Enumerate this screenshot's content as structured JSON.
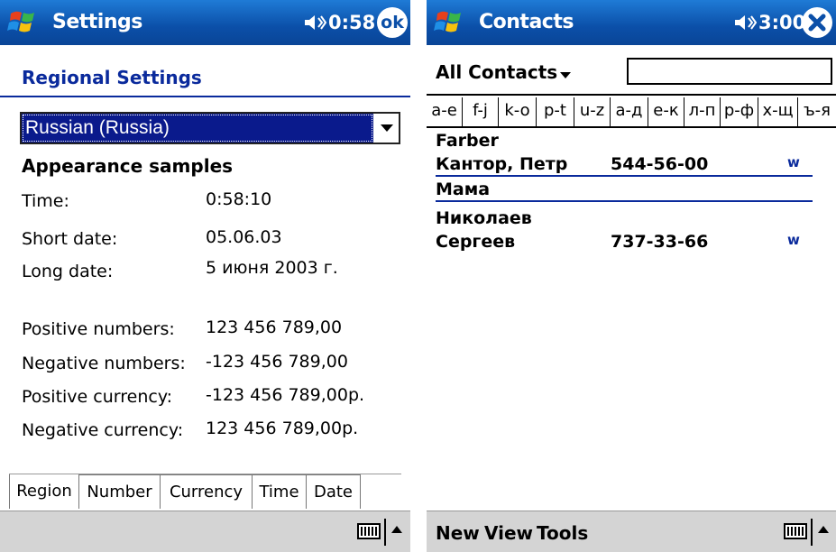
{
  "left": {
    "title": "Settings",
    "time": "0:58",
    "ok_label": "ok",
    "heading": "Regional Settings",
    "locale_selected": "Russian (Russia)",
    "samples_heading": "Appearance samples",
    "rows": [
      {
        "label": "Time:",
        "value": "0:58:10"
      },
      {
        "label": "Short date:",
        "value": "05.06.03"
      },
      {
        "label": "Long date:",
        "value": "5 июня 2003 г."
      },
      {
        "label": "Positive numbers:",
        "value": "123 456 789,00"
      },
      {
        "label": "Negative numbers:",
        "value": "-123 456 789,00"
      },
      {
        "label": "Positive currency:",
        "value": "-123 456 789,00р."
      },
      {
        "label": "Negative currency:",
        "value": "123 456 789,00р."
      }
    ],
    "tabs": [
      "Region",
      "Number",
      "Currency",
      "Time",
      "Date"
    ],
    "active_tab": "Region"
  },
  "right": {
    "title": "Contacts",
    "time": "3:00",
    "filter_label": "All Contacts",
    "search_value": "",
    "alpha_tabs": [
      "a-e",
      "f-j",
      "k-o",
      "p-t",
      "u-z",
      "а-д",
      "е-к",
      "л-п",
      "р-ф",
      "х-щ",
      "ъ-я"
    ],
    "contacts": [
      {
        "name": "Farber",
        "phone": "",
        "flag": ""
      },
      {
        "name": "Кантор, Петр",
        "phone": "544-56-00",
        "flag": "w"
      },
      {
        "name": "Мама",
        "phone": "",
        "flag": ""
      },
      {
        "name": "Николаев",
        "phone": "",
        "flag": ""
      },
      {
        "name": "Сергеев",
        "phone": "737-33-66",
        "flag": "w"
      }
    ],
    "menu": [
      "New",
      "View",
      "Tools"
    ]
  },
  "colors": {
    "titlebar": "#0b4fa8",
    "accent": "#0a2a9c",
    "selection": "#0a1a8c",
    "menubar": "#d4d4d4"
  },
  "icons": [
    "windows-start-icon",
    "speaker-icon",
    "ok-icon",
    "close-icon",
    "keyboard-icon",
    "sip-arrow-icon",
    "dropdown-arrow-icon"
  ]
}
